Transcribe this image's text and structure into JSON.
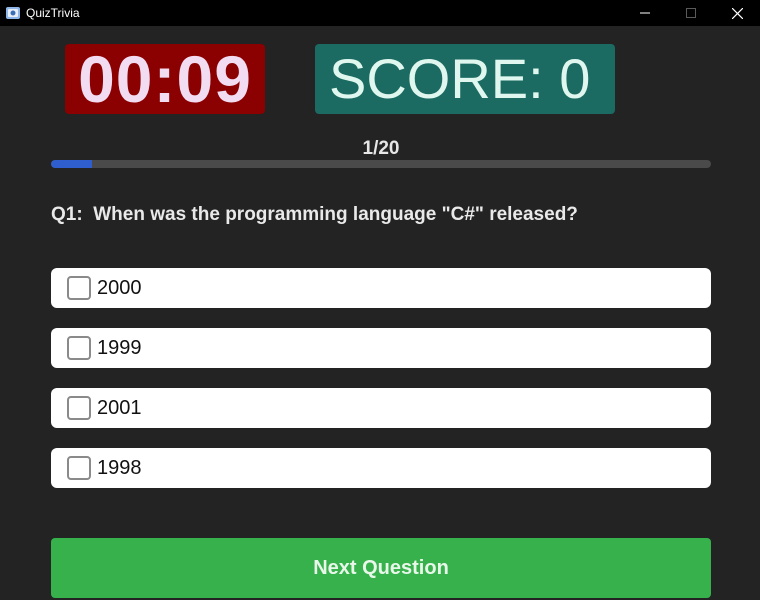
{
  "window": {
    "title": "QuizTrivia",
    "app_icon": "quiz-app-icon",
    "controls": [
      "minimize-icon",
      "maximize-icon",
      "close-icon"
    ]
  },
  "timer": {
    "value": "00:09"
  },
  "score": {
    "text": "SCORE: 0"
  },
  "progress": {
    "label": "1/20",
    "fraction": 0.0625
  },
  "question": {
    "text": "Q1:  When was the programming language \"C#\" released?"
  },
  "options": [
    {
      "label": "2000",
      "checked": false
    },
    {
      "label": "1999",
      "checked": false
    },
    {
      "label": "2001",
      "checked": false
    },
    {
      "label": "1998",
      "checked": false
    }
  ],
  "next_button": {
    "label": "Next Question"
  },
  "colors": {
    "timer_bg": "#8b0000",
    "score_bg": "#1b6b62",
    "progress_fill": "#2f5fcf",
    "next_button_bg": "#36b14c",
    "background": "#232323"
  }
}
